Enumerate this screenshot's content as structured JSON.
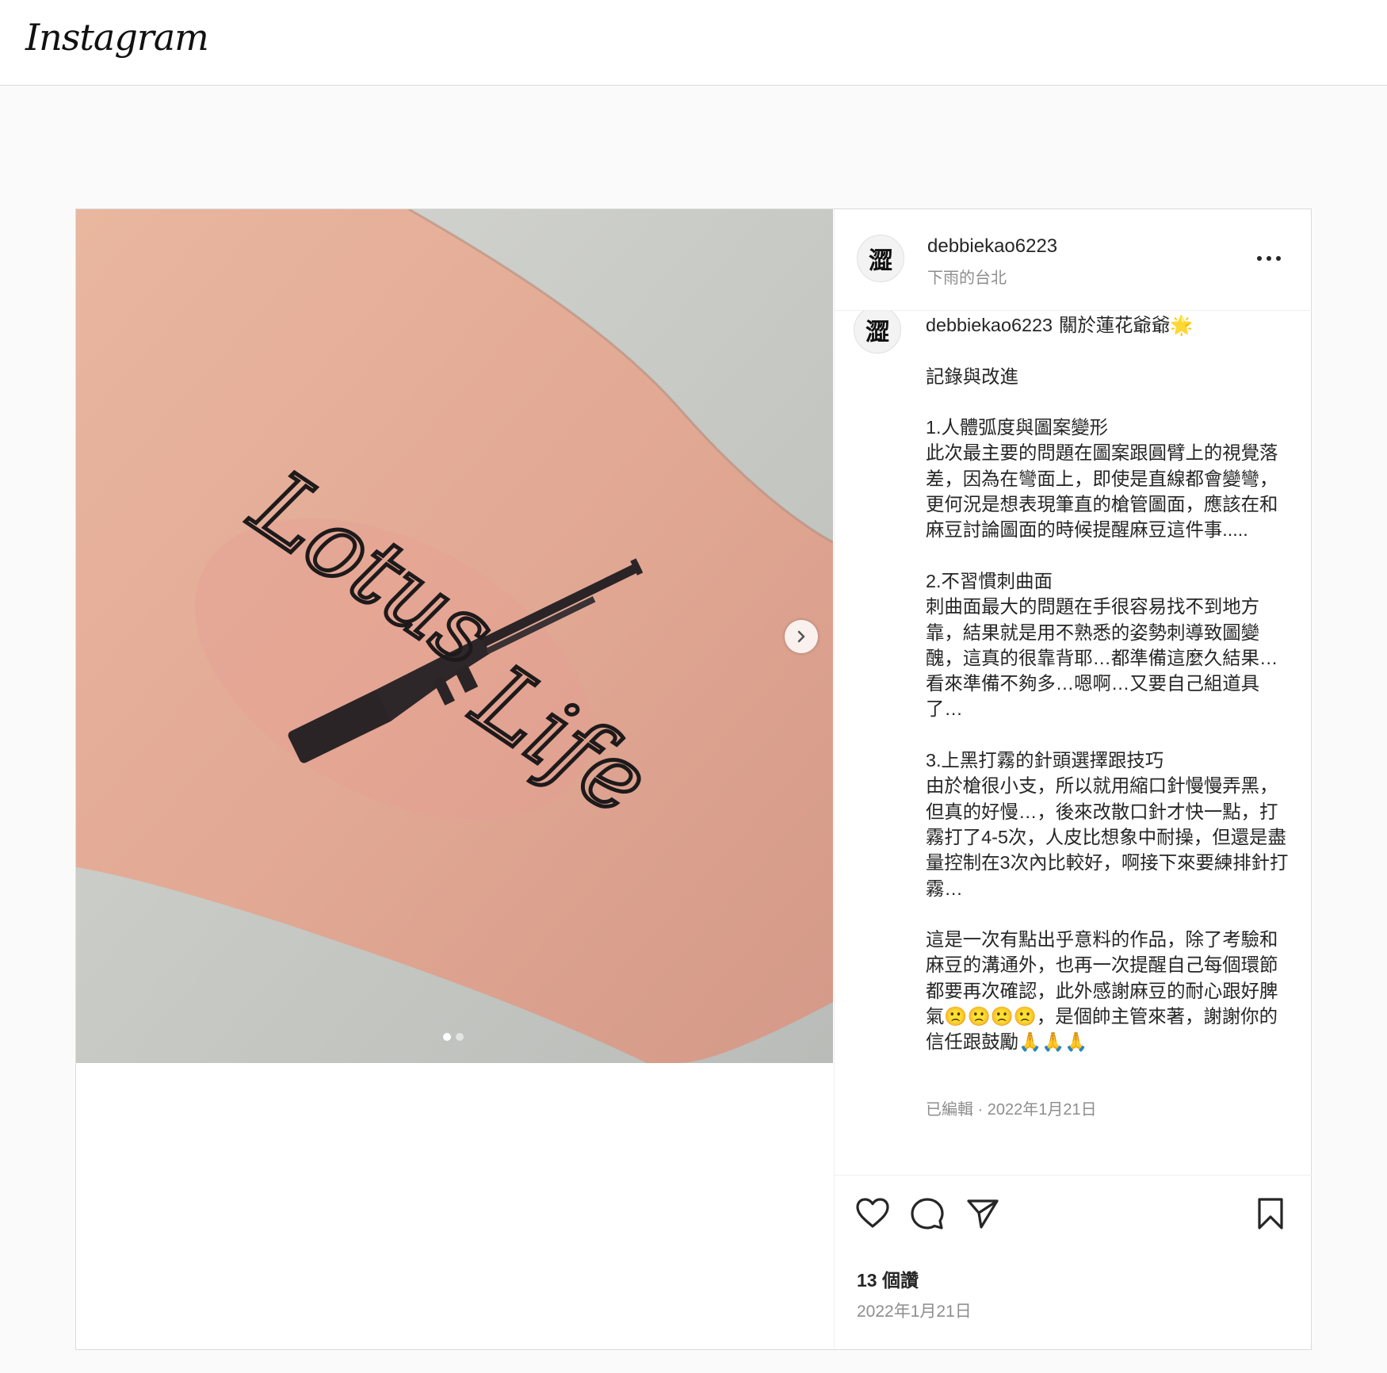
{
  "app": {
    "brand": "Instagram"
  },
  "post": {
    "username": "debbiekao6223",
    "location": "下雨的台北",
    "avatar_text": "澀",
    "image": {
      "tattoo_text_1": "Lotus",
      "tattoo_text_2": "Life",
      "carousel_count": 2,
      "carousel_active": 0
    },
    "caption": {
      "username": "debbiekao6223",
      "text": "關於蓮花爺爺🌟\n\n記錄與改進\n\n1.人體弧度與圖案變形\n此次最主要的問題在圖案跟圓臂上的視覺落差，因為在彎面上，即使是直線都會變彎，更何況是想表現筆直的槍管圖面，應該在和麻豆討論圖面的時候提醒麻豆這件事.....\n\n2.不習慣刺曲面\n刺曲面最大的問題在手很容易找不到地方靠，結果就是用不熟悉的姿勢刺導致圖變醜，這真的很靠背耶…都準備這麼久結果…看來準備不夠多…嗯啊…又要自己組道具了…\n\n3.上黑打霧的針頭選擇跟技巧\n由於槍很小支，所以就用縮口針慢慢弄黑，但真的好慢…，後來改散口針才快一點，打霧打了4-5次，人皮比想象中耐操，但還是盡量控制在3次內比較好，啊接下來要練排針打霧…\n\n這是一次有點出乎意料的作品，除了考驗和麻豆的溝通外，也再一次提醒自己每個環節都要再次確認，此外感謝麻豆的耐心跟好脾氣🙁🙁🙁🙁，是個帥主管來著，謝謝你的信任跟鼓勵🙏🙏🙏",
      "meta": "已編輯 · 2022年1月21日"
    },
    "likes": "13 個讚",
    "date": "2022年1月21日"
  },
  "icons": [
    "heart-icon",
    "comment-icon",
    "share-icon",
    "bookmark-icon",
    "more-icon",
    "chevron-right-icon"
  ]
}
